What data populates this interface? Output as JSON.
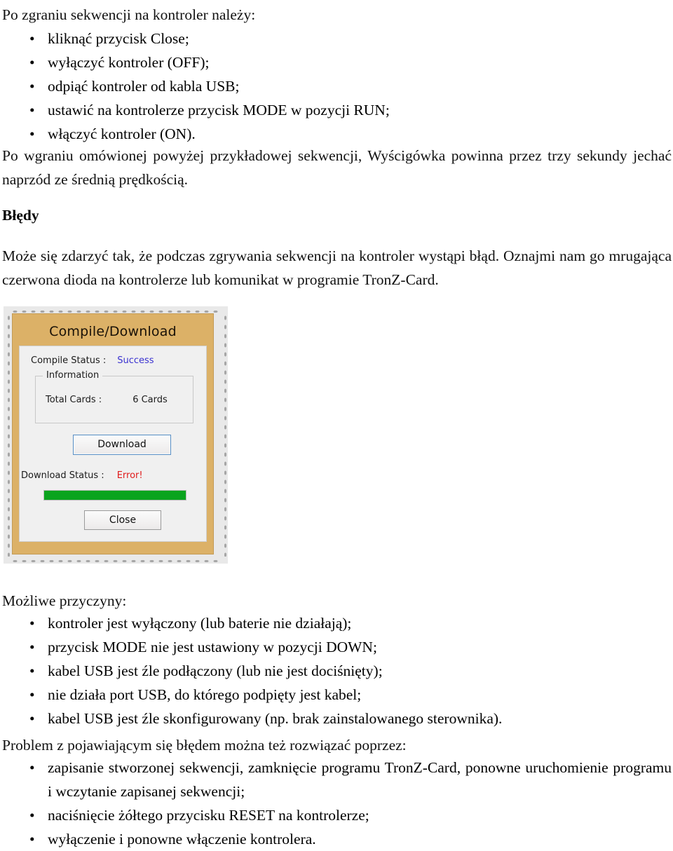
{
  "document": {
    "intro_line": "Po zgraniu sekwencji na kontroler należy:",
    "steps": [
      "kliknąć przycisk Close;",
      "wyłączyć kontroler (OFF);",
      "odpiąć kontroler od kabla USB;",
      "ustawić na kontrolerze przycisk MODE w pozycji RUN;",
      "włączyć kontroler (ON)."
    ],
    "paragraph_after_steps": "Po wgraniu omówionej powyżej przykładowej sekwencji, Wyścigówka powinna przez trzy sekundy jechać naprzód ze średnią prędkością.",
    "errors_heading": "Błędy",
    "errors_paragraph": "Może się zdarzyć tak, że podczas zgrywania sekwencji na kontroler wystąpi błąd. Oznajmi nam go mrugająca czerwona dioda na kontrolerze lub komunikat w programie TronZ-Card.",
    "causes_heading": "Możliwe przyczyny:",
    "causes": [
      "kontroler jest wyłączony (lub baterie nie działają);",
      "przycisk MODE nie jest ustawiony w pozycji DOWN;",
      "kabel USB jest źle podłączony (lub nie jest dociśnięty);",
      "nie działa port USB, do którego podpięty jest kabel;",
      "kabel USB jest źle skonfigurowany (np. brak zainstalowanego sterownika)."
    ],
    "solutions_heading": "Problem z pojawiającym się błędem można też rozwiązać poprzez:",
    "solutions": [
      "zapisanie stworzonej sekwencji, zamknięcie programu TronZ-Card, ponowne uruchomienie programu i wczytanie zapisanej sekwencji;",
      "naciśnięcie żółtego przycisku RESET na kontrolerze;",
      "wyłączenie i ponowne włączenie kontrolera."
    ],
    "bullet_glyph": "•"
  },
  "figure": {
    "dialog": {
      "title": "Compile/Download",
      "compile_status_label": "Compile Status :",
      "compile_status_value": "Success",
      "compile_status_color": "#3a32d0",
      "information_legend": "Information",
      "total_cards_label": "Total Cards :",
      "total_cards_value": "6 Cards",
      "download_button_label": "Download",
      "download_status_label": "Download Status :",
      "download_status_value": "Error!",
      "download_status_color": "#e01b1b",
      "progress_percent": "100",
      "progress_color": "#0aa41e",
      "close_button_label": "Close",
      "title_bar_color": "#dcb167",
      "body_color": "#f0f0f0"
    }
  }
}
